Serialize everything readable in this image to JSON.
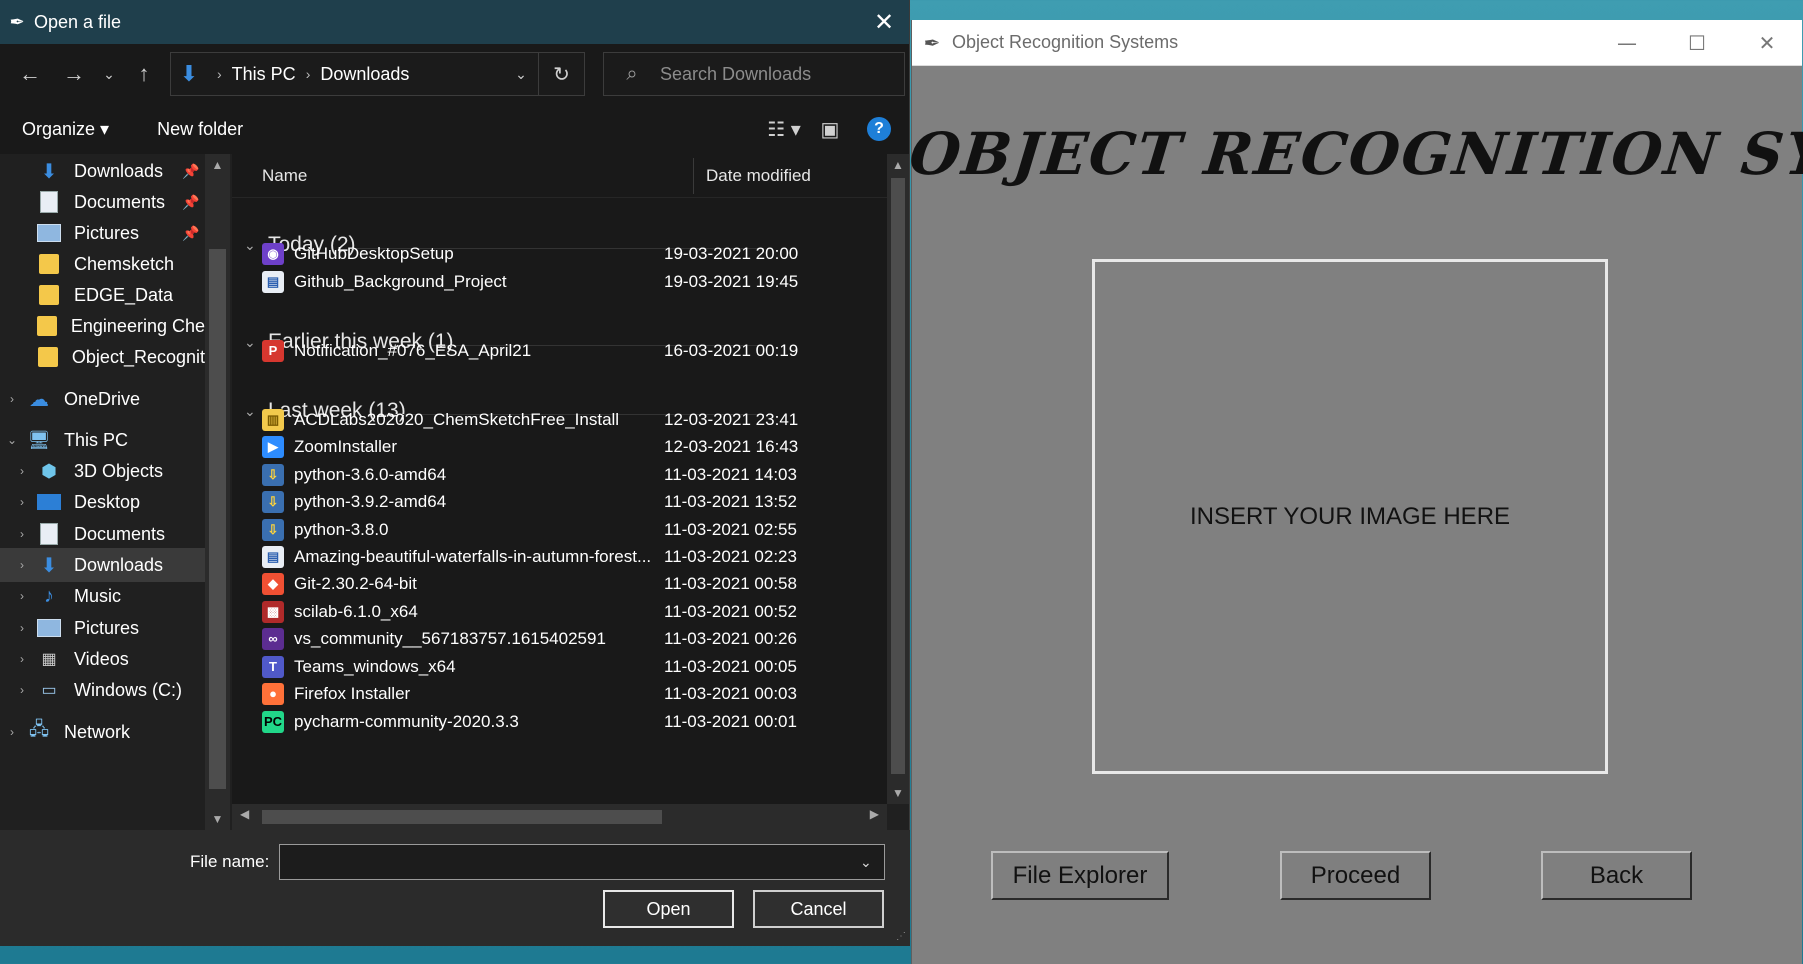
{
  "app": {
    "title": "Object Recognition Systems",
    "heading": "OBJECT RECOGNITION SYSTEMS",
    "image_placeholder": "INSERT YOUR IMAGE HERE",
    "buttons": {
      "file_explorer": "File Explorer",
      "proceed": "Proceed",
      "back": "Back"
    },
    "controls": {
      "minimize": "—",
      "maximize": "☐",
      "close": "✕"
    }
  },
  "dialog": {
    "title": "Open a file",
    "close": "✕",
    "breadcrumb": [
      "This PC",
      "Downloads"
    ],
    "search_placeholder": "Search Downloads",
    "toolbar": {
      "organize": "Organize ▾",
      "new_folder": "New folder"
    },
    "nav_items": [
      {
        "label": "Downloads",
        "icon": "download-arrow-icon",
        "pinned": true,
        "indent": 1
      },
      {
        "label": "Documents",
        "icon": "document-icon",
        "pinned": true,
        "indent": 1
      },
      {
        "label": "Pictures",
        "icon": "picture-icon",
        "pinned": true,
        "indent": 1
      },
      {
        "label": "Chemsketch",
        "icon": "folder-icon",
        "pinned": false,
        "indent": 1
      },
      {
        "label": "EDGE_Data",
        "icon": "folder-icon",
        "pinned": false,
        "indent": 1
      },
      {
        "label": "Engineering Che",
        "icon": "folder-icon",
        "pinned": false,
        "indent": 1
      },
      {
        "label": "Object_Recognit",
        "icon": "folder-icon",
        "pinned": false,
        "indent": 1
      },
      {
        "label": "OneDrive",
        "icon": "cloud-icon",
        "pinned": false,
        "indent": 0
      },
      {
        "label": "This PC",
        "icon": "computer-icon",
        "pinned": false,
        "indent": 0
      },
      {
        "label": "3D Objects",
        "icon": "cube-icon",
        "pinned": false,
        "indent": 1
      },
      {
        "label": "Desktop",
        "icon": "desktop-icon",
        "pinned": false,
        "indent": 1
      },
      {
        "label": "Documents",
        "icon": "document-icon",
        "pinned": false,
        "indent": 1
      },
      {
        "label": "Downloads",
        "icon": "download-arrow-icon",
        "pinned": false,
        "indent": 1
      },
      {
        "label": "Music",
        "icon": "music-note-icon",
        "pinned": false,
        "indent": 1
      },
      {
        "label": "Pictures",
        "icon": "picture-icon",
        "pinned": false,
        "indent": 1
      },
      {
        "label": "Videos",
        "icon": "video-icon",
        "pinned": false,
        "indent": 1
      },
      {
        "label": "Windows (C:)",
        "icon": "drive-icon",
        "pinned": false,
        "indent": 1
      },
      {
        "label": "Network",
        "icon": "network-icon",
        "pinned": false,
        "indent": 0
      }
    ],
    "columns": {
      "name": "Name",
      "date": "Date modified"
    },
    "groups": [
      {
        "label": "Today (2)",
        "files": [
          {
            "name": "GitHubDesktopSetup",
            "date": "19-03-2021 20:00",
            "icon": "github-icon"
          },
          {
            "name": "Github_Background_Project",
            "date": "19-03-2021 19:45",
            "icon": "document-icon"
          }
        ]
      },
      {
        "label": "Earlier this week (1)",
        "files": [
          {
            "name": "Notification_#076_ESA_April21",
            "date": "16-03-2021 00:19",
            "icon": "pdf-icon"
          }
        ]
      },
      {
        "label": "Last week (13)",
        "files": [
          {
            "name": "ACDLabs202020_ChemSketchFree_Install",
            "date": "12-03-2021 23:41",
            "icon": "zip-icon"
          },
          {
            "name": "ZoomInstaller",
            "date": "12-03-2021 16:43",
            "icon": "zoom-icon"
          },
          {
            "name": "python-3.6.0-amd64",
            "date": "11-03-2021 14:03",
            "icon": "installer-icon"
          },
          {
            "name": "python-3.9.2-amd64",
            "date": "11-03-2021 13:52",
            "icon": "installer-icon"
          },
          {
            "name": "python-3.8.0",
            "date": "11-03-2021 02:55",
            "icon": "installer-icon"
          },
          {
            "name": "Amazing-beautiful-waterfalls-in-autumn-forest...",
            "date": "11-03-2021 02:23",
            "icon": "document-icon"
          },
          {
            "name": "Git-2.30.2-64-bit",
            "date": "11-03-2021 00:58",
            "icon": "git-icon"
          },
          {
            "name": "scilab-6.1.0_x64",
            "date": "11-03-2021 00:52",
            "icon": "scilab-icon"
          },
          {
            "name": "vs_community__567183757.1615402591",
            "date": "11-03-2021 00:26",
            "icon": "visual-studio-icon"
          },
          {
            "name": "Teams_windows_x64",
            "date": "11-03-2021 00:05",
            "icon": "teams-icon"
          },
          {
            "name": "Firefox Installer",
            "date": "11-03-2021 00:03",
            "icon": "firefox-icon"
          },
          {
            "name": "pycharm-community-2020.3.3",
            "date": "11-03-2021 00:01",
            "icon": "pycharm-icon"
          }
        ]
      }
    ],
    "file_name_label": "File name:",
    "file_name_value": "",
    "open_label": "Open",
    "cancel_label": "Cancel"
  }
}
